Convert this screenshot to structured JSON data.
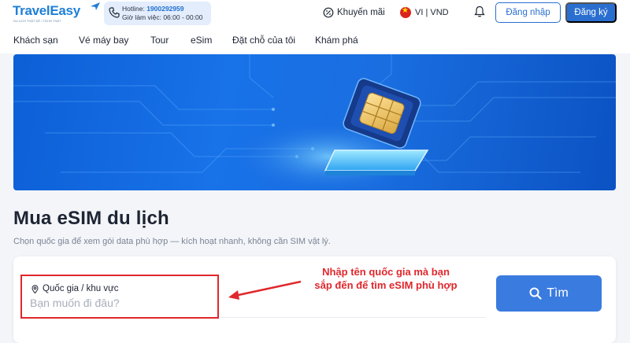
{
  "header": {
    "logo_text": "TravelEasy",
    "logo_slogan": "DU LỊCH THẬT DỄ • TẢI ĐI THẬT",
    "hotline_label": "Hotline: ",
    "hotline_number": "1900292959",
    "hours": "Giờ làm việc: 06:00 - 00:00",
    "promo_label": "Khuyến mãi",
    "language_currency": "VI | VND",
    "login_label": "Đăng nhập",
    "register_label": "Đăng ký",
    "icons": [
      "phone-icon",
      "discount-icon",
      "vietnam-flag-icon",
      "bell-icon"
    ]
  },
  "nav": {
    "items": [
      {
        "label": "Khách sạn"
      },
      {
        "label": "Vé máy bay"
      },
      {
        "label": "Tour"
      },
      {
        "label": "eSim"
      },
      {
        "label": "Đặt chỗ của tôi"
      },
      {
        "label": "Khám phá"
      }
    ]
  },
  "main": {
    "title": "Mua eSIM du lịch",
    "subtitle": "Chọn quốc gia để xem gói data phù hợp — kích hoạt nhanh, không cần SIM vật lý.",
    "search": {
      "label": "Quốc gia / khu vực",
      "placeholder": "Bạn muốn đi đâu?",
      "value": "",
      "button_label": "Tìm"
    },
    "annotation": {
      "line1": "Nhập tên quốc gia mà bạn",
      "line2": "sắp đến để tìm eSIM phù hợp"
    }
  },
  "colors": {
    "brand_blue": "#2a6fd0",
    "search_button": "#3a7be0",
    "annotation_red": "#e0272c",
    "banner_blue": "#1872e8"
  }
}
